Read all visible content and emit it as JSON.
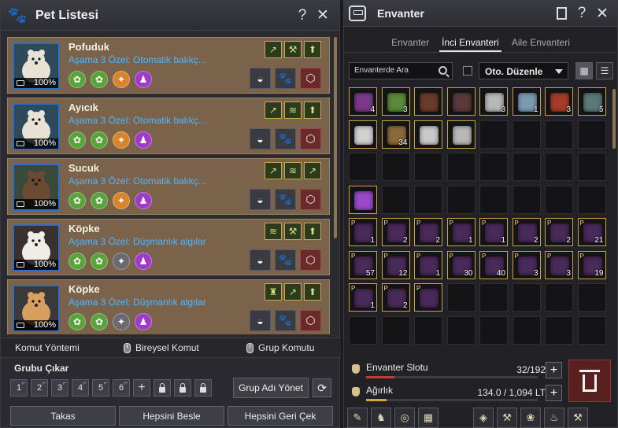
{
  "pet_window": {
    "title": "Pet Listesi",
    "title_icon": "paw-icon",
    "help_label": "?",
    "close_label": "✕",
    "pets": [
      {
        "name": "Pofuduk",
        "skill": "Aşama 3 Özel: Otomatik balıkç...",
        "level": "100%",
        "talents": [
          "↗",
          "⚒",
          "⬆"
        ],
        "portrait": "polar-bear",
        "skill_colors": [
          "green",
          "green",
          "orange",
          "purple"
        ]
      },
      {
        "name": "Ayıcık",
        "skill": "Aşama 3 Özel: Otomatik balıkç...",
        "level": "100%",
        "talents": [
          "↗",
          "≋",
          "⬆"
        ],
        "portrait": "polar-bear",
        "skill_colors": [
          "green",
          "green",
          "orange",
          "purple"
        ]
      },
      {
        "name": "Sucuk",
        "skill": "Aşama 3 Özel: Otomatik balıkç...",
        "level": "100%",
        "talents": [
          "↗",
          "≋",
          "↗"
        ],
        "portrait": "otter",
        "skill_colors": [
          "green",
          "green",
          "orange",
          "purple"
        ]
      },
      {
        "name": "Köpke",
        "skill": "Aşama 3 Özel: Düşmanlık algılar",
        "level": "100%",
        "talents": [
          "≋",
          "⚒",
          "⬆"
        ],
        "portrait": "dog-husky",
        "skill_colors": [
          "green",
          "green",
          "gray",
          "purple"
        ]
      },
      {
        "name": "Köpke",
        "skill": "Aşama 3 Özel: Düşmanlık algılar",
        "level": "100%",
        "talents": [
          "♜",
          "↗",
          "⬆"
        ],
        "portrait": "dog-shiba",
        "skill_colors": [
          "green",
          "green",
          "gray",
          "purple"
        ]
      }
    ],
    "commands": {
      "method": "Komut Yöntemi",
      "individual": "Bireysel Komut",
      "group": "Grup Komutu"
    },
    "group_section": {
      "label": "Grubu Çıkar",
      "buttons": [
        "1",
        "2",
        "3",
        "4",
        "5",
        "6"
      ],
      "rename": "Grup Adı Yönet"
    },
    "bottom_buttons": [
      "Takas",
      "Hepsini Besle",
      "Hepsini Geri Çek"
    ]
  },
  "inventory_window": {
    "title": "Envanter",
    "help_label": "?",
    "close_label": "✕",
    "tabs": [
      "Envanter",
      "İnci Envanteri",
      "Aile Envanteri"
    ],
    "active_tab": 1,
    "search_placeholder": "Envanterde Ara",
    "auto_sort": "Oto. Düzenle",
    "slots": {
      "label": "Envanter Slotu",
      "value": "32/192",
      "fill_fraction": 0.167
    },
    "weight": {
      "label": "Ağırlık",
      "value": "134.0 / 1,094 LT",
      "fill_fraction": 0.12
    },
    "items": [
      {
        "row": 0,
        "col": 0,
        "qty": "4",
        "color": "#7a3a8a"
      },
      {
        "row": 0,
        "col": 1,
        "qty": "3",
        "color": "#5a8a3a"
      },
      {
        "row": 0,
        "col": 2,
        "qty": "",
        "color": "#6a3a2a"
      },
      {
        "row": 0,
        "col": 3,
        "qty": "",
        "color": "#5a3a3a"
      },
      {
        "row": 0,
        "col": 4,
        "qty": "3",
        "color": "#b8b8b8"
      },
      {
        "row": 0,
        "col": 5,
        "qty": "1",
        "color": "#7a9ab0"
      },
      {
        "row": 0,
        "col": 6,
        "qty": "3",
        "color": "#a83a2a"
      },
      {
        "row": 0,
        "col": 7,
        "qty": "5",
        "color": "#5a7a7a"
      },
      {
        "row": 1,
        "col": 0,
        "qty": "",
        "color": "#d0d0d0"
      },
      {
        "row": 1,
        "col": 1,
        "qty": "34",
        "color": "#8a6a3a"
      },
      {
        "row": 1,
        "col": 2,
        "qty": "",
        "color": "#c8c8c8"
      },
      {
        "row": 1,
        "col": 3,
        "qty": "",
        "color": "#b8b8b8"
      },
      {
        "row": 3,
        "col": 0,
        "qty": "",
        "color": "#9a4ac9"
      },
      {
        "row": 4,
        "col": 0,
        "qty": "1",
        "color": "#4a2a5a",
        "p": true
      },
      {
        "row": 4,
        "col": 1,
        "qty": "2",
        "color": "#4a2a5a",
        "p": true
      },
      {
        "row": 4,
        "col": 2,
        "qty": "2",
        "color": "#4a2a5a",
        "p": true
      },
      {
        "row": 4,
        "col": 3,
        "qty": "1",
        "color": "#4a2a5a",
        "p": true
      },
      {
        "row": 4,
        "col": 4,
        "qty": "1",
        "color": "#4a2a5a",
        "p": true
      },
      {
        "row": 4,
        "col": 5,
        "qty": "2",
        "color": "#4a2a5a",
        "p": true
      },
      {
        "row": 4,
        "col": 6,
        "qty": "2",
        "color": "#4a2a5a",
        "p": true
      },
      {
        "row": 4,
        "col": 7,
        "qty": "21",
        "color": "#4a2a5a",
        "p": true
      },
      {
        "row": 5,
        "col": 0,
        "qty": "57",
        "color": "#4a2a5a",
        "p": true
      },
      {
        "row": 5,
        "col": 1,
        "qty": "12",
        "color": "#4a2a5a",
        "p": true
      },
      {
        "row": 5,
        "col": 2,
        "qty": "1",
        "color": "#4a2a5a",
        "p": true
      },
      {
        "row": 5,
        "col": 3,
        "qty": "30",
        "color": "#4a2a5a",
        "p": true
      },
      {
        "row": 5,
        "col": 4,
        "qty": "40",
        "color": "#4a2a5a",
        "p": true
      },
      {
        "row": 5,
        "col": 5,
        "qty": "3",
        "color": "#4a2a5a",
        "p": true
      },
      {
        "row": 5,
        "col": 6,
        "qty": "3",
        "color": "#4a2a5a",
        "p": true
      },
      {
        "row": 5,
        "col": 7,
        "qty": "19",
        "color": "#4a2a5a",
        "p": true
      },
      {
        "row": 6,
        "col": 0,
        "qty": "1",
        "color": "#4a2a5a",
        "p": true
      },
      {
        "row": 6,
        "col": 1,
        "qty": "2",
        "color": "#4a2a5a",
        "p": true
      },
      {
        "row": 6,
        "col": 2,
        "qty": "",
        "color": "#4a2a5a",
        "p": true
      }
    ],
    "bottom_tools": [
      "magic-wand-icon",
      "horse-icon",
      "pearl-icon",
      "grid-icon",
      "lantern-icon",
      "axe-icon",
      "swirl-icon",
      "cooking-icon",
      "hammer-icon"
    ]
  }
}
